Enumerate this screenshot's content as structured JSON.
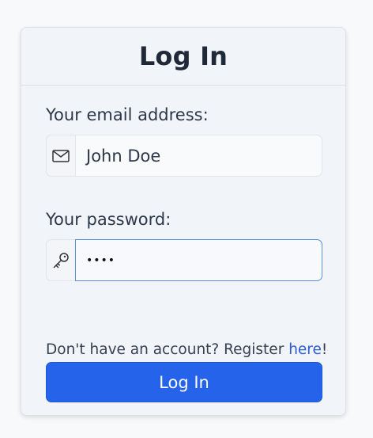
{
  "card": {
    "title": "Log In"
  },
  "email": {
    "label": "Your email address:",
    "value": "John Doe",
    "icon": "envelope-icon"
  },
  "password": {
    "label": "Your password:",
    "value": "••••",
    "icon": "key-icon"
  },
  "register": {
    "prefix": "Don't have an account? Register ",
    "link_text": "here",
    "suffix": "!"
  },
  "submit": {
    "label": "Log In"
  },
  "colors": {
    "primary": "#2563eb",
    "link": "#2a5dd3",
    "focus_border": "#5b8fd6"
  }
}
